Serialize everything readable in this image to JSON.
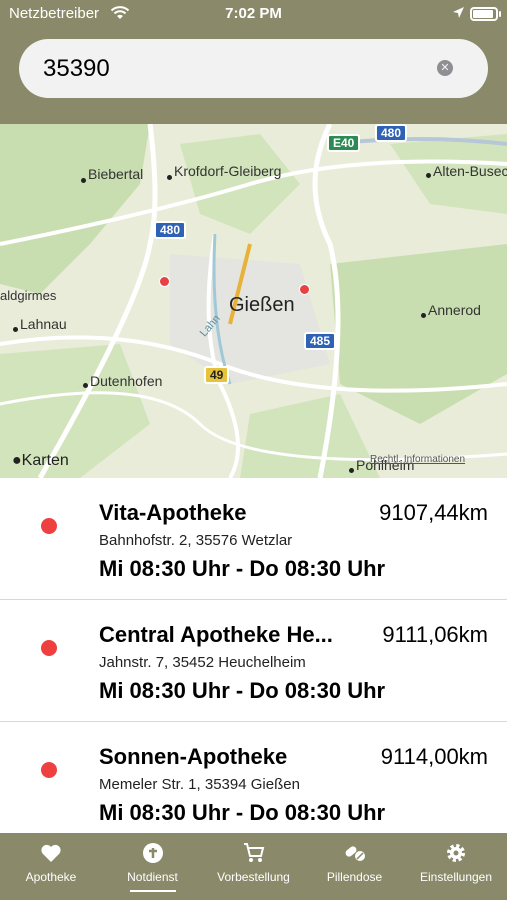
{
  "status_bar": {
    "carrier": "Netzbetreiber",
    "time": "7:02 PM"
  },
  "search": {
    "value": "35390",
    "clear_icon": "clear-circle-icon"
  },
  "map": {
    "places": {
      "biebertal": "Biebertal",
      "krofdorf": "Krofdorf-Gleiberg",
      "alten_buseck": "Alten-Buseck",
      "waldgirmes": "aldgirmes",
      "lahnau": "Lahnau",
      "giessen": "Gießen",
      "annerod": "Annerod",
      "dutenhofen": "Dutenhofen",
      "pohlheim": "Pohlheim",
      "lahn": "Lahn"
    },
    "road_shields": {
      "a480_top": "480",
      "e40": "E40",
      "a480_left": "480",
      "a485": "485",
      "b49": "49"
    },
    "attribution": "Karten",
    "legal": "Rechtl. Informationen",
    "colors": {
      "land": "#e9ecd9",
      "forest": "#c9deb0",
      "road": "#ffffff",
      "pin": "#e84141"
    }
  },
  "pharmacies": [
    {
      "name": "Vita-Apotheke",
      "distance": "9107,44km",
      "address": "Bahnhofstr. 2, 35576 Wetzlar",
      "hours": "Mi 08:30 Uhr - Do 08:30 Uhr"
    },
    {
      "name": "Central Apotheke He...",
      "distance": "9111,06km",
      "address": "Jahnstr. 7, 35452 Heuchelheim",
      "hours": "Mi 08:30 Uhr - Do 08:30 Uhr"
    },
    {
      "name": "Sonnen-Apotheke",
      "distance": "9114,00km",
      "address": "Memeler Str. 1, 35394 Gießen",
      "hours": "Mi 08:30 Uhr - Do 08:30 Uhr"
    }
  ],
  "tabbar": {
    "active": "Notdienst",
    "tabs": [
      {
        "label": "Apotheke",
        "icon": "heart-icon"
      },
      {
        "label": "Notdienst",
        "icon": "emergency-icon"
      },
      {
        "label": "Vorbestellung",
        "icon": "cart-icon"
      },
      {
        "label": "Pillendose",
        "icon": "pills-icon"
      },
      {
        "label": "Einstellungen",
        "icon": "gear-icon"
      }
    ]
  },
  "colors": {
    "accent": "#8a8a6a",
    "status_dot": "#ef4040"
  }
}
